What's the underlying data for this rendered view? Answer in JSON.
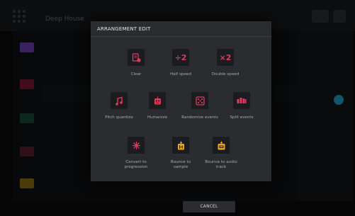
{
  "colors": {
    "accent_pink": "#e23a5e",
    "accent_orange": "#f0a21b",
    "dialog_bg": "#2a2c30",
    "tile_bg": "#1b1c1f"
  },
  "background": {
    "title": "Deep House"
  },
  "dialog": {
    "title": "ARRANGEMENT EDIT",
    "actions": [
      {
        "label": "Clear",
        "icon": "clear-icon",
        "glyph": ""
      },
      {
        "label": "Half speed",
        "icon": "half-speed-icon",
        "glyph": "÷2"
      },
      {
        "label": "Double speed",
        "icon": "double-speed-icon",
        "glyph": "×2"
      },
      {
        "label": "Pitch quantize",
        "icon": "pitch-quantize-icon",
        "glyph": ""
      },
      {
        "label": "Humanize",
        "icon": "humanize-icon",
        "glyph": ""
      },
      {
        "label": "Randomize events",
        "icon": "randomize-icon",
        "glyph": ""
      },
      {
        "label": "Split events",
        "icon": "split-events-icon",
        "glyph": ""
      },
      {
        "label": "Convert to\nprogression",
        "icon": "convert-progression-icon",
        "glyph": ""
      },
      {
        "label": "Bounce to\nsample",
        "icon": "bounce-sample-icon",
        "glyph": ""
      },
      {
        "label": "Bounce to audio\ntrack",
        "icon": "bounce-audio-icon",
        "glyph": ""
      }
    ]
  },
  "footer": {
    "cancel_label": "CANCEL"
  }
}
